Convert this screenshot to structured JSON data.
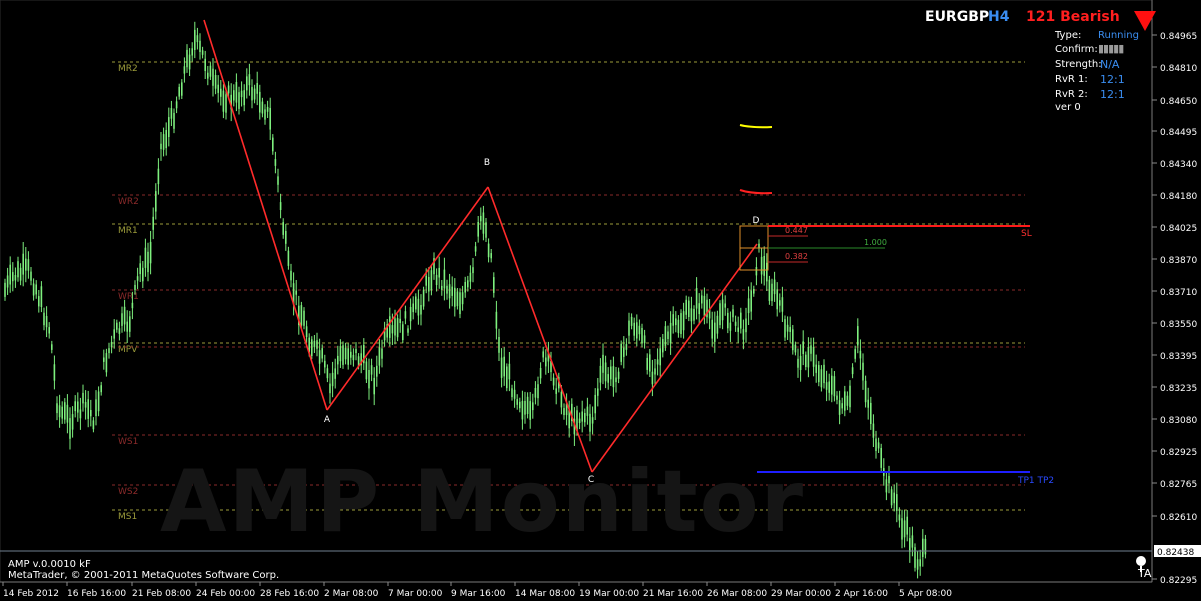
{
  "header": {
    "symbol": "EURGBP",
    "timeframe": "H4",
    "pattern": "121 Bearish"
  },
  "info": [
    {
      "label": "Type:",
      "value": "Running"
    },
    {
      "label": "Confirm:",
      "value": "▮▮▮▮▮"
    },
    {
      "label": "Strength:",
      "value": "N/A"
    },
    {
      "label": "RvR 1:",
      "value": "12:1"
    },
    {
      "label": "RvR 2:",
      "value": "12:1"
    },
    {
      "label": "ver 0",
      "value": ""
    }
  ],
  "watermark": "AMP Monitor",
  "footer": {
    "line1": "AMP v.0.0010 kF",
    "line2": "MetaTrader, © 2001-2011 MetaQuotes Software Corp."
  },
  "price_axis": [
    "0.84965",
    "0.84810",
    "0.84650",
    "0.84495",
    "0.84340",
    "0.84180",
    "0.84025",
    "0.83870",
    "0.83710",
    "0.83550",
    "0.83395",
    "0.83235",
    "0.83080",
    "0.82925",
    "0.82765",
    "0.82610",
    "0.82438",
    "0.82295"
  ],
  "current_price": "0.82438",
  "time_axis": [
    "14 Feb 2012",
    "16 Feb 16:00",
    "21 Feb 08:00",
    "24 Feb 00:00",
    "28 Feb 16:00",
    "2 Mar 08:00",
    "7 Mar 00:00",
    "9 Mar 16:00",
    "14 Mar 08:00",
    "19 Mar 00:00",
    "21 Mar 16:00",
    "26 Mar 08:00",
    "29 Mar 00:00",
    "2 Apr 16:00",
    "5 Apr 08:00"
  ],
  "levels": [
    {
      "label": "MR2",
      "color": "#9b9b3a"
    },
    {
      "label": "WR2",
      "color": "#8a2a2a"
    },
    {
      "label": "MR1",
      "color": "#9b9b3a"
    },
    {
      "label": "WR1",
      "color": "#8a2a2a"
    },
    {
      "label": "MPV",
      "color": "#9b9b3a"
    },
    {
      "label": "WS1",
      "color": "#8a2a2a"
    },
    {
      "label": "WS2",
      "color": "#8a2a2a"
    },
    {
      "label": "MS1",
      "color": "#9b9b3a"
    }
  ],
  "points": [
    "A",
    "B",
    "C",
    "D"
  ],
  "fib_labels": [
    "0.447",
    "1.000",
    "0.382"
  ],
  "targets": {
    "sl": "SL",
    "tp": "TP1 TP2"
  },
  "colors": {
    "candle": "#7ef07e",
    "pattern": "#ff2b2b",
    "target": "#1e1eff",
    "accent": "#3a8df0"
  },
  "chart_data": {
    "type": "candlestick",
    "ylim": [
      0.82295,
      0.85
    ],
    "pattern_prices": {
      "A": 0.8315,
      "B": 0.8424,
      "C": 0.8287,
      "D": 0.8397
    }
  }
}
